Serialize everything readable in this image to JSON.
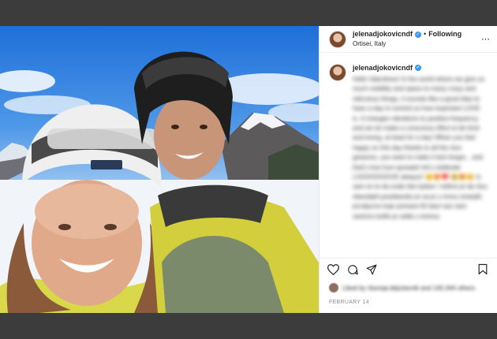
{
  "header": {
    "username": "jelenadjokovicndf",
    "separator": "•",
    "follow_label": "Following",
    "location": "Ortisei, Italy",
    "more_icon": "⋯"
  },
  "caption": {
    "username": "jelenadjokovicndf",
    "text": "Hello Valentines! In the world where we give so much visibility and space to many crazy and ridiculous things, it sounds like a good idea to have a day to remind us how important LOVE is. It changes vibrations to positive frequency and we do make a conscious effort to be kind and loving, at least for a day! When you feel happy on this day thanks to all the nice gestures, you want to make it last longer... and that's how love spreads! let's celebrate LOOOOOOOVE always!! 😊😍❤️ 😂😍😊 Is sam ex te da svaki dan ljubav i vidimo je da nisu obezeljeli posebanda se sa je u mnou smanjih prvoljucno koje pomaze lili slavi nas nam sanivno bolilo je zalite u koinou"
  },
  "actions": {
    "like_icon": "heart-icon",
    "comment_icon": "comment-icon",
    "share_icon": "share-icon",
    "save_icon": "bookmark-icon"
  },
  "likes": {
    "text": "Liked by rbsonja.bkjiclavnik and 140,344 others"
  },
  "date": "FEBRUARY 14"
}
